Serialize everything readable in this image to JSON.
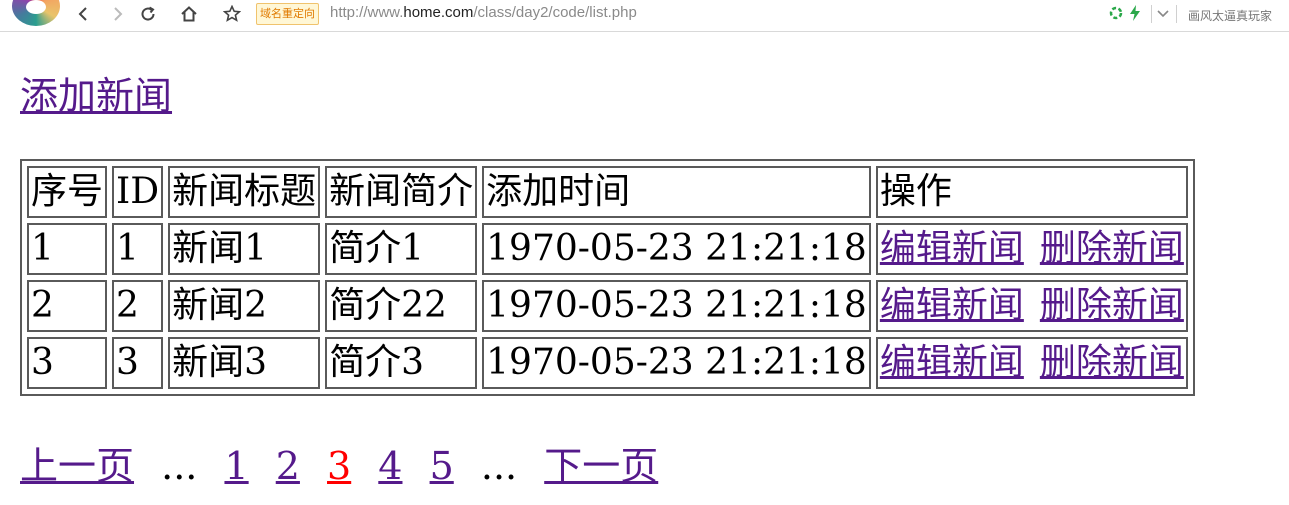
{
  "browser": {
    "redirect_badge": "域名重定向",
    "url_prefix": "http://www.",
    "url_domain": "home.com",
    "url_path": "/class/day2/code/list.php",
    "side_text": "画风太逼真玩家"
  },
  "page": {
    "add_link": "添加新闻",
    "table": {
      "headers": [
        "序号",
        "ID",
        "新闻标题",
        "新闻简介",
        "添加时间",
        "操作"
      ],
      "rows": [
        {
          "seq": "1",
          "id": "1",
          "title": "新闻1",
          "intro": "简介1",
          "time": "1970-05-23 21:21:18",
          "edit": "编辑新闻",
          "delete": "删除新闻"
        },
        {
          "seq": "2",
          "id": "2",
          "title": "新闻2",
          "intro": "简介22",
          "time": "1970-05-23 21:21:18",
          "edit": "编辑新闻",
          "delete": "删除新闻"
        },
        {
          "seq": "3",
          "id": "3",
          "title": "新闻3",
          "intro": "简介3",
          "time": "1970-05-23 21:21:18",
          "edit": "编辑新闻",
          "delete": "删除新闻"
        }
      ]
    },
    "pager": {
      "prev": "上一页",
      "ellipsis": "...",
      "pages": [
        "1",
        "2",
        "3",
        "4",
        "5"
      ],
      "current": "3",
      "next": "下一页"
    }
  },
  "colors": {
    "link": "#551a8b",
    "current_page": "#ff0000",
    "table_border": "#5a5a5a"
  }
}
